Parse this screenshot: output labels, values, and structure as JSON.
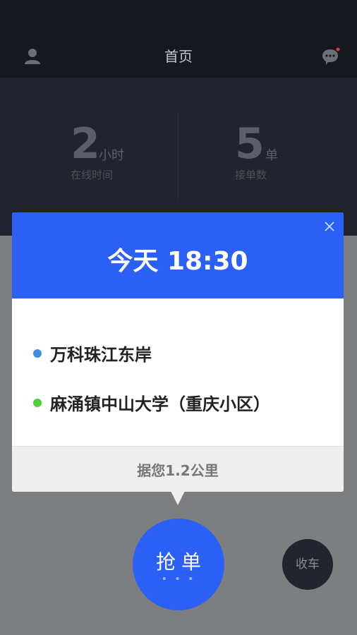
{
  "header": {
    "title": "首页",
    "user_icon": "user-icon",
    "message_icon": "chat-bubble-icon",
    "message_badge_color": "#e53935"
  },
  "stats": {
    "online": {
      "value": "2",
      "unit": "小时",
      "label": "在线时间"
    },
    "orders": {
      "value": "5",
      "unit": "单",
      "label": "接单数"
    }
  },
  "order_card": {
    "time": "今天 18:30",
    "close_icon": "close-icon",
    "pickup": {
      "address": "万科珠江东岸",
      "dot_color": "#3f8fe0"
    },
    "dropoff": {
      "address": "麻涌镇中山大学（重庆小区）",
      "dot_color": "#4cd137"
    },
    "distance": "据您1.2公里"
  },
  "actions": {
    "grab_label": "抢单",
    "grab_dots": "• • •",
    "stop_label": "收车"
  },
  "colors": {
    "accent": "#2a60f6",
    "dark_bg": "#161820",
    "overlay": "#7d7e80"
  }
}
